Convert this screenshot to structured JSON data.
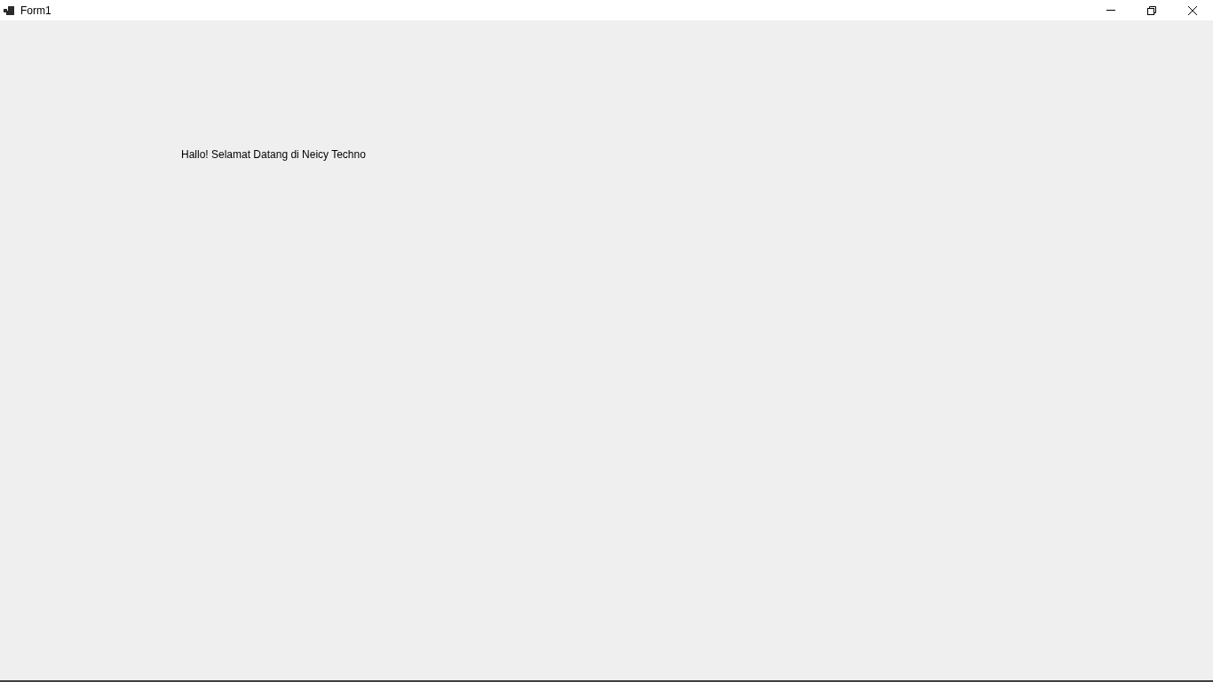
{
  "window": {
    "title": "Form1",
    "controls": [
      {
        "kind": "minimize"
      },
      {
        "kind": "restore"
      },
      {
        "kind": "close"
      }
    ]
  },
  "form": {
    "label": "Hallo! Selamat Datang di Neicy Techno"
  }
}
